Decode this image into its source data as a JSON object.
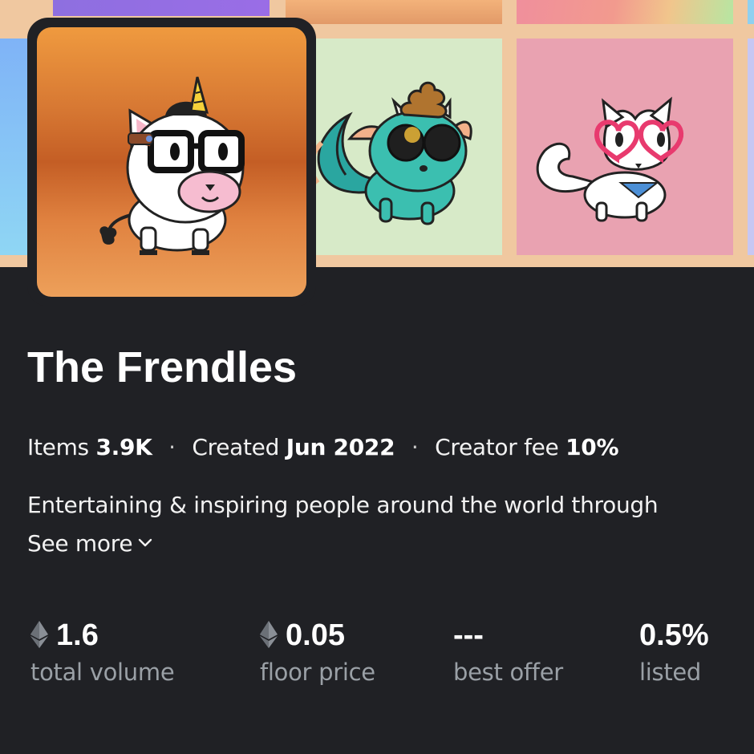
{
  "collection": {
    "name": "The Frendles",
    "avatar_alt": "unicorn-cat-avatar"
  },
  "meta": {
    "items_label": "Items",
    "items_value": "3.9K",
    "created_label": "Created",
    "created_value": "Jun 2022",
    "fee_label": "Creator fee",
    "fee_value": "10%",
    "separator": "·"
  },
  "description": {
    "text": "Entertaining & inspiring people around the world through",
    "see_more": "See more"
  },
  "stats": [
    {
      "value": "1.6",
      "label": "total volume",
      "eth_icon": true
    },
    {
      "value": "0.05",
      "label": "floor price",
      "eth_icon": true
    },
    {
      "value": "---",
      "label": "best offer",
      "eth_icon": false
    },
    {
      "value": "0.5%",
      "label": "listed",
      "eth_icon": false
    }
  ],
  "colors": {
    "background": "#202125",
    "banner": "#f0c8a0",
    "muted_text": "#9aa0a6"
  },
  "icons": {
    "currency": "ethereum-icon",
    "expand": "chevron-down-icon"
  }
}
